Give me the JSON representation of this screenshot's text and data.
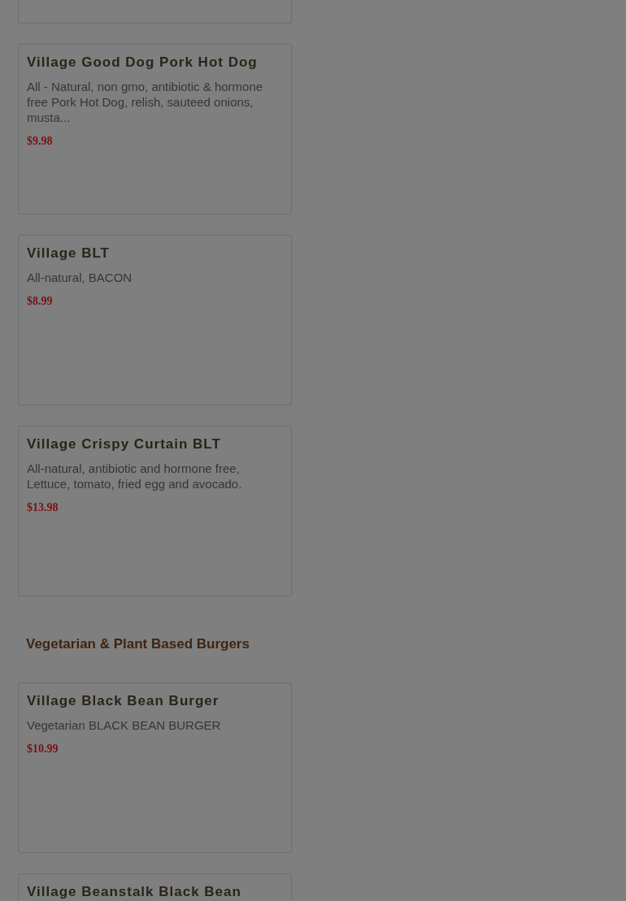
{
  "sections": [
    {
      "items": [
        {
          "name": "Village Good Dog Pork Hot Dog",
          "description": "All - Natural, non gmo, antibiotic & hormone free Pork Hot Dog, relish, sauteed onions, musta...",
          "price": "$9.98"
        },
        {
          "name": "Village BLT",
          "description": "All-natural, BACON",
          "price": "$8.99"
        },
        {
          "name": "Village Crispy Curtain BLT",
          "description": "All-natural, antibiotic and hormone free, Lettuce, tomato, fried egg and avocado.",
          "price": "$13.98"
        }
      ]
    },
    {
      "heading": "Vegetarian & Plant Based Burgers",
      "items": [
        {
          "name": "Village Black Bean Burger",
          "description": "Vegetarian BLACK BEAN BURGER",
          "price": "$10.99"
        },
        {
          "name": "Village Beanstalk Black Bean"
        }
      ]
    }
  ]
}
